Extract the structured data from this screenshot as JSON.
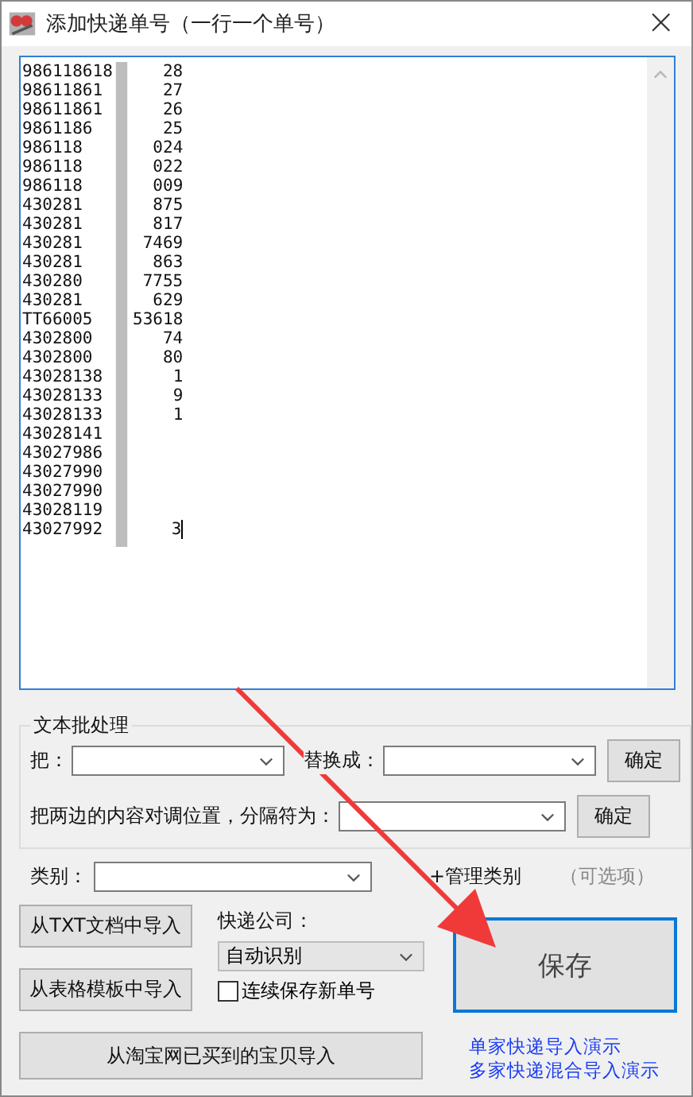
{
  "window": {
    "title": "添加快递单号（一行一个单号）",
    "close": "×"
  },
  "numbers": [
    {
      "start": "986118618",
      "end": "28"
    },
    {
      "start": "98611861",
      "end": "27"
    },
    {
      "start": "98611861",
      "end": "26"
    },
    {
      "start": "9861186",
      "end": "25"
    },
    {
      "start": "986118",
      "end": "024"
    },
    {
      "start": "986118",
      "end": "022"
    },
    {
      "start": "986118",
      "end": "009"
    },
    {
      "start": "430281",
      "end": "875"
    },
    {
      "start": "430281",
      "end": "817"
    },
    {
      "start": "430281",
      "end": "7469"
    },
    {
      "start": "430281",
      "end": "863"
    },
    {
      "start": "430280",
      "end": "7755"
    },
    {
      "start": "430281",
      "end": "629"
    },
    {
      "start": "TT66005",
      "end": "53618"
    },
    {
      "start": "4302800",
      "end": "74"
    },
    {
      "start": "4302800",
      "end": "80"
    },
    {
      "start": "43028138",
      "end": "1"
    },
    {
      "start": "43028133",
      "end": "9"
    },
    {
      "start": "43028133",
      "end": "1"
    },
    {
      "start": "43028141"
    },
    {
      "start": "43027986"
    },
    {
      "start": "43027990"
    },
    {
      "start": "43027990"
    },
    {
      "start": "43028119"
    },
    {
      "start": "43027992",
      "end": "3"
    }
  ],
  "batch": {
    "title": "文本批处理",
    "replace_from_label": "把：",
    "replace_to_label": "替换成：",
    "swap_label": "把两边的内容对调位置，分隔符为：",
    "confirm_buttons": [
      "确定",
      "确定"
    ]
  },
  "category": {
    "label": "类别：",
    "manage_link": "+管理类别",
    "hint": "（可选项）"
  },
  "import_buttons": [
    "从TXT文档中导入",
    "从表格模板中导入"
  ],
  "courier": {
    "label": "快递公司：",
    "value": "自动识别"
  },
  "continuous_save": {
    "label": "连续保存新单号",
    "checked": false
  },
  "save_button": "保存",
  "taobao_button": "从淘宝网已买到的宝贝导入",
  "links": [
    "单家快递导入演示",
    "多家快递混合导入演示"
  ]
}
